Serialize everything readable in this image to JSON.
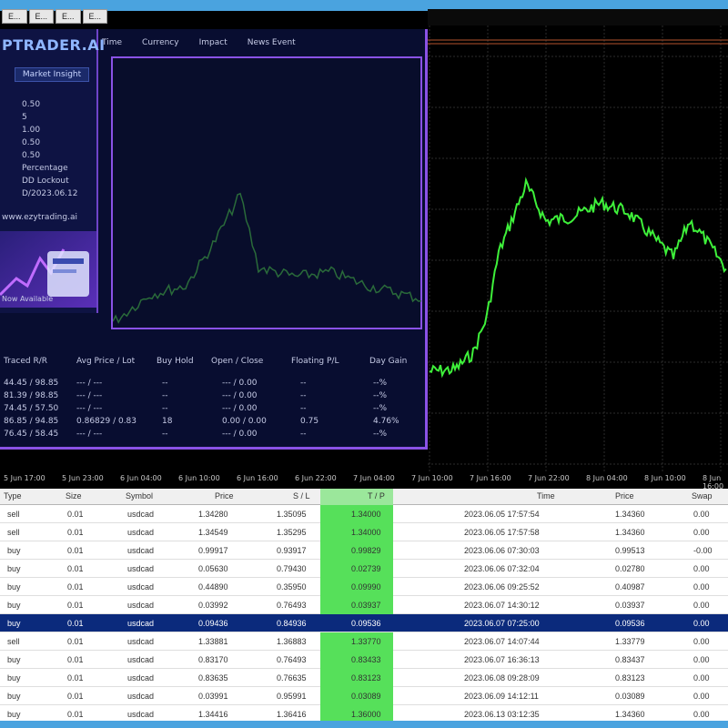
{
  "top_tabs": [
    "E...",
    "E...",
    "E...",
    "E..."
  ],
  "overlay": {
    "brand": "PTRADER.AI",
    "market_button": "Market Insight",
    "menu": [
      "Time",
      "Currency",
      "Impact",
      "News Event"
    ],
    "kv": [
      {
        "k": "",
        "v": "0.50"
      },
      {
        "k": "",
        "v": "5"
      },
      {
        "k": "",
        "v": "1.00"
      },
      {
        "k": "",
        "v": "0.50"
      },
      {
        "k": "",
        "v": "0.50"
      },
      {
        "k": "",
        "v": "Percentage"
      },
      {
        "k": "",
        "v": "DD Lockout"
      },
      {
        "k": "",
        "v": "D/2023.06.12"
      }
    ],
    "site": "www.ezytrading.ai",
    "promo_label": "Now Available",
    "table_headers": [
      "Traced R/R",
      "Avg Price / Lot",
      "Buy Hold",
      "Open / Close",
      "Floating P/L",
      "Day Gain"
    ],
    "table_rows": [
      [
        "44.45 / 98.85",
        "--- / ---",
        "--",
        "--- / 0.00",
        "--",
        "--%"
      ],
      [
        "81.39 / 98.85",
        "--- / ---",
        "--",
        "--- / 0.00",
        "--",
        "--%"
      ],
      [
        "74.45 / 57.50",
        "--- / ---",
        "--",
        "--- / 0.00",
        "--",
        "--%"
      ],
      [
        "86.85 / 94.85",
        "0.86829 / 0.83",
        "18",
        "0.00 / 0.00",
        "0.75",
        "4.76%"
      ],
      [
        "76.45 / 58.45",
        "--- / ---",
        "--",
        "--- / 0.00",
        "--",
        "--%"
      ]
    ]
  },
  "time_axis": [
    "5 Jun 17:00",
    "5 Jun 23:00",
    "6 Jun 04:00",
    "6 Jun 10:00",
    "6 Jun 16:00",
    "6 Jun 22:00",
    "7 Jun 04:00",
    "7 Jun 10:00",
    "7 Jun 16:00",
    "7 Jun 22:00",
    "8 Jun 04:00",
    "8 Jun 10:00",
    "8 Jun 16:00"
  ],
  "trades": {
    "headers": [
      "Type",
      "Size",
      "Symbol",
      "Price",
      "S / L",
      "T / P",
      "Time",
      "Price",
      "Swap"
    ],
    "rows": [
      {
        "type": "sell",
        "size": "0.01",
        "symbol": "usdcad",
        "price": "1.34280",
        "sl": "1.35095",
        "tp": "1.34000",
        "time": "2023.06.05 17:57:54",
        "cur": "1.34360",
        "swap": "0.00",
        "sel": false
      },
      {
        "type": "sell",
        "size": "0.01",
        "symbol": "usdcad",
        "price": "1.34549",
        "sl": "1.35295",
        "tp": "1.34000",
        "time": "2023.06.05 17:57:58",
        "cur": "1.34360",
        "swap": "0.00",
        "sel": false
      },
      {
        "type": "buy",
        "size": "0.01",
        "symbol": "usdcad",
        "price": "0.99917",
        "sl": "0.93917",
        "tp": "0.99829",
        "time": "2023.06.06 07:30:03",
        "cur": "0.99513",
        "swap": "-0.00",
        "sel": false
      },
      {
        "type": "buy",
        "size": "0.01",
        "symbol": "usdcad",
        "price": "0.05630",
        "sl": "0.79430",
        "tp": "0.02739",
        "time": "2023.06.06 07:32:04",
        "cur": "0.02780",
        "swap": "0.00",
        "sel": false
      },
      {
        "type": "buy",
        "size": "0.01",
        "symbol": "usdcad",
        "price": "0.44890",
        "sl": "0.35950",
        "tp": "0.09990",
        "time": "2023.06.06 09:25:52",
        "cur": "0.40987",
        "swap": "0.00",
        "sel": false
      },
      {
        "type": "buy",
        "size": "0.01",
        "symbol": "usdcad",
        "price": "0.03992",
        "sl": "0.76493",
        "tp": "0.03937",
        "time": "2023.06.07 14:30:12",
        "cur": "0.03937",
        "swap": "0.00",
        "sel": false
      },
      {
        "type": "buy",
        "size": "0.01",
        "symbol": "usdcad",
        "price": "0.09436",
        "sl": "0.84936",
        "tp": "0.09536",
        "time": "2023.06.07 07:25:00",
        "cur": "0.09536",
        "swap": "0.00",
        "sel": true
      },
      {
        "type": "sell",
        "size": "0.01",
        "symbol": "usdcad",
        "price": "1.33881",
        "sl": "1.36883",
        "tp": "1.33770",
        "time": "2023.06.07 14:07:44",
        "cur": "1.33779",
        "swap": "0.00",
        "sel": false
      },
      {
        "type": "buy",
        "size": "0.01",
        "symbol": "usdcad",
        "price": "0.83170",
        "sl": "0.76493",
        "tp": "0.83433",
        "time": "2023.06.07 16:36:13",
        "cur": "0.83437",
        "swap": "0.00",
        "sel": false
      },
      {
        "type": "buy",
        "size": "0.01",
        "symbol": "usdcad",
        "price": "0.83635",
        "sl": "0.76635",
        "tp": "0.83123",
        "time": "2023.06.08 09:28:09",
        "cur": "0.83123",
        "swap": "0.00",
        "sel": false
      },
      {
        "type": "buy",
        "size": "0.01",
        "symbol": "usdcad",
        "price": "0.03991",
        "sl": "0.95991",
        "tp": "0.03089",
        "time": "2023.06.09 14:12:11",
        "cur": "0.03089",
        "swap": "0.00",
        "sel": false
      },
      {
        "type": "buy",
        "size": "0.01",
        "symbol": "usdcad",
        "price": "1.34416",
        "sl": "1.36416",
        "tp": "1.36000",
        "time": "2023.06.13 03:12:35",
        "cur": "1.34360",
        "swap": "0.00",
        "sel": false
      }
    ]
  },
  "colors": {
    "chart_line": "#3ef03a",
    "grid": "#2d2d2d",
    "accent_purple": "#8a52e6",
    "highlight_green": "#56e05a",
    "selected_row": "#0b2a7c",
    "top_bar": "#4aa3df"
  }
}
